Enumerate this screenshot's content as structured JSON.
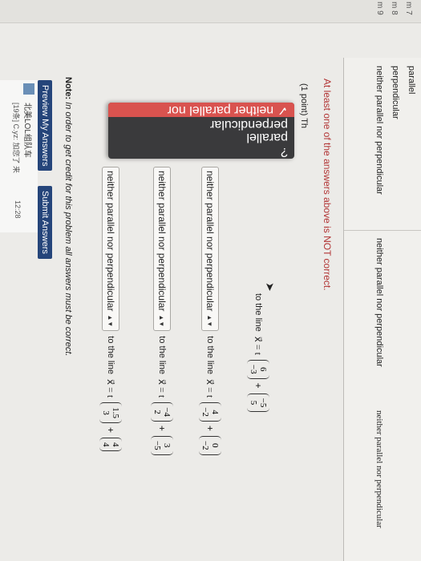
{
  "side_list": [
    "m 7",
    "m 8",
    "m 9"
  ],
  "results": {
    "col1_options": [
      "parallel",
      "perpendicular",
      "neither parallel nor perpendicular"
    ],
    "col2_value": "neither parallel nor perpendicular",
    "col3_value": "neither parallel nor perpendicular"
  },
  "warning": "At least one of the answers above is NOT correct.",
  "problem": {
    "label": "(1 point) Th",
    "rows": [
      {
        "select": "neither parallel nor perpendicular",
        "line_text": "to the line",
        "x_label": "x⃗ = t",
        "m1": [
          "6",
          "−3"
        ],
        "m2": [
          "−5",
          "5"
        ]
      },
      {
        "select": "neither parallel nor perpendicular",
        "line_text": "to the line",
        "x_label": "x⃗ = t",
        "m1": [
          "4",
          "−2"
        ],
        "m2": [
          "0",
          "−2"
        ]
      },
      {
        "select": "neither parallel nor perpendicular",
        "line_text": "to the line",
        "x_label": "x⃗ = t",
        "m1": [
          "−4",
          "2"
        ],
        "m2": [
          "3",
          "−5"
        ]
      },
      {
        "select": "neither parallel nor perpendicular",
        "line_text": "to the line",
        "x_label": "x⃗ = t",
        "m1": [
          "1.5",
          "3"
        ],
        "m2": [
          "4",
          "4"
        ]
      }
    ]
  },
  "dropdown": {
    "options": [
      "?",
      "parallel",
      "perpendicular",
      "✓ neither parallel nor perpendicular"
    ],
    "selected_index": 3
  },
  "note": {
    "bold": "Note:",
    "text": " In order to get credit for this problem all answers must be correct."
  },
  "buttons": {
    "preview": "Preview My Answers",
    "submit": "Submit Answers"
  },
  "chat": {
    "title": "北美LOL组队车",
    "sub": "[19条] C.yz: 加您了 来",
    "time": "12:28"
  },
  "colors": {
    "accent": "#25457a",
    "selected": "#d9534f",
    "warning": "#b23636"
  }
}
